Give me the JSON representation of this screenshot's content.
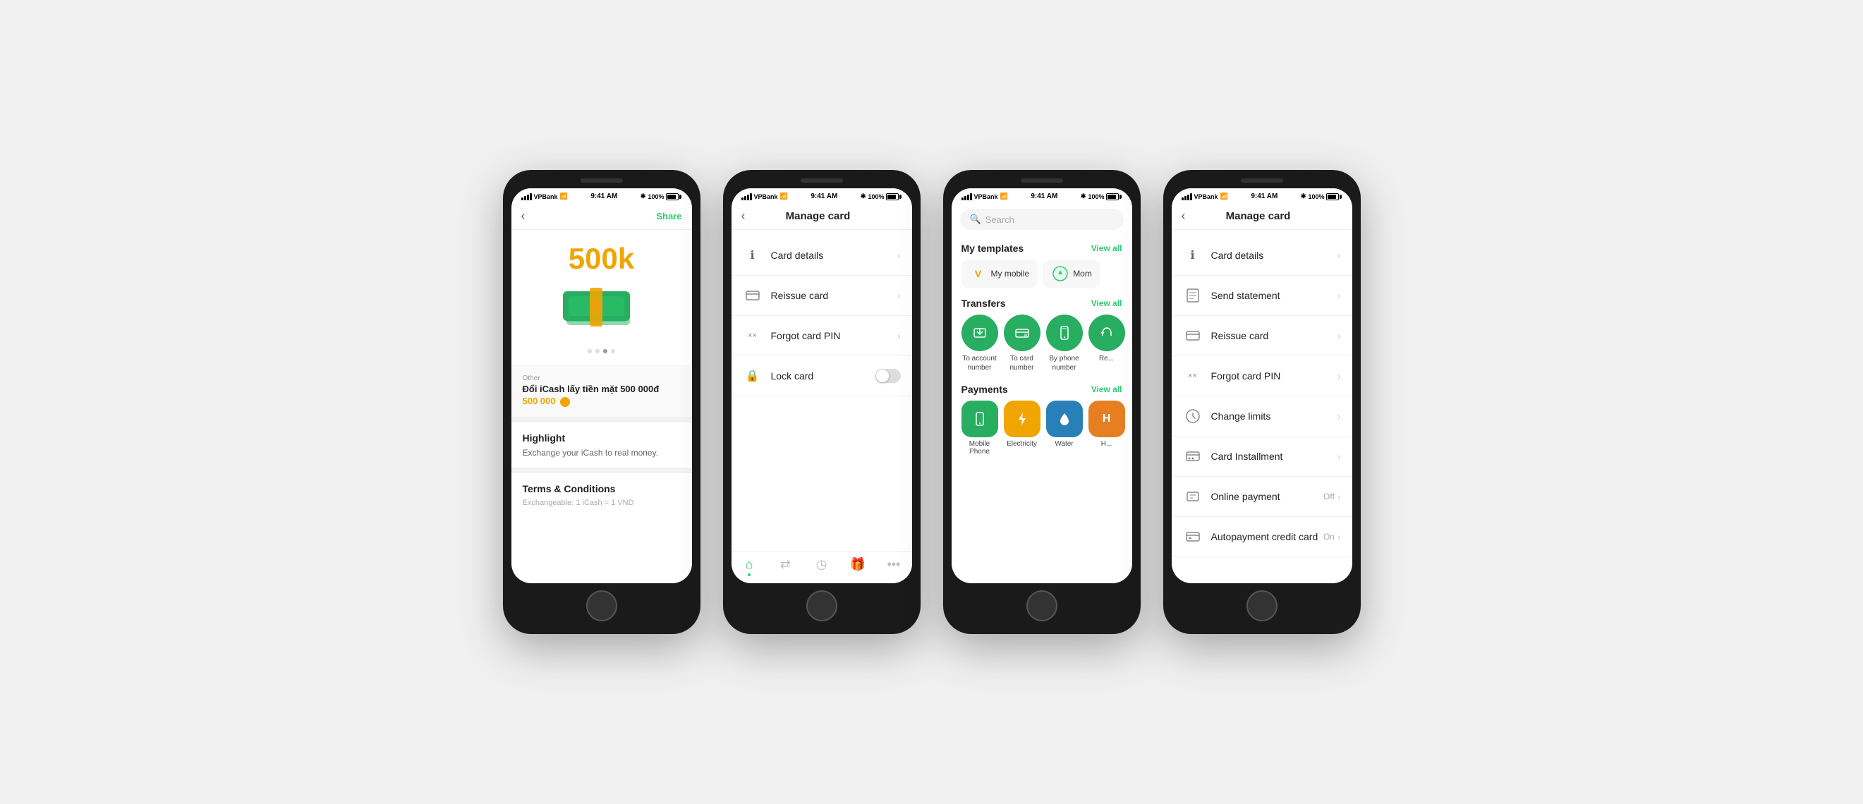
{
  "page": {
    "background": "#f0f0f0"
  },
  "statusBar": {
    "carrier": "VPBank",
    "time": "9:41 AM",
    "battery": "100%"
  },
  "phone1": {
    "navBack": "‹",
    "navAction": "Share",
    "amount": "500k",
    "category": "Other",
    "description": "Đổi iCash lấy tiền mặt 500 000đ",
    "amountValue": "500 000",
    "highlight": "Highlight",
    "highlightText": "Exchange your iCash to real money.",
    "tc": "Terms & Conditions",
    "tcText": "Exchangeable: 1 iCash = 1 VND"
  },
  "phone2": {
    "title": "Manage card",
    "navBack": "‹",
    "menuItems": [
      {
        "icon": "ℹ",
        "label": "Card details",
        "type": "chevron"
      },
      {
        "icon": "▭",
        "label": "Reissue card",
        "type": "chevron"
      },
      {
        "icon": "××",
        "label": "Forgot card PIN",
        "type": "chevron"
      },
      {
        "icon": "🔒",
        "label": "Lock card",
        "type": "toggle"
      }
    ],
    "tabs": [
      {
        "icon": "⌂",
        "label": "",
        "active": true
      },
      {
        "icon": "⇄",
        "label": "",
        "active": false
      },
      {
        "icon": "◷",
        "label": "",
        "active": false
      },
      {
        "icon": "🎁",
        "label": "",
        "active": false
      },
      {
        "icon": "•••",
        "label": "",
        "active": false
      }
    ]
  },
  "phone3": {
    "searchPlaceholder": "Search",
    "templates": {
      "title": "My templates",
      "viewAll": "View all",
      "items": [
        {
          "name": "My mobile",
          "logo": "V",
          "logoColor": "#f0a500"
        },
        {
          "name": "Mom",
          "logo": "V",
          "logoColor": "#2ecc71"
        }
      ]
    },
    "transfers": {
      "title": "Transfers",
      "viewAll": "View all",
      "items": [
        {
          "icon": "⌂",
          "label": "To account number"
        },
        {
          "icon": "▭",
          "label": "To card number"
        },
        {
          "icon": "📱",
          "label": "By phone number"
        },
        {
          "icon": "↩",
          "label": "Re..."
        }
      ]
    },
    "payments": {
      "title": "Payments",
      "viewAll": "View all",
      "items": [
        {
          "icon": "📱",
          "label": "Mobile Phone",
          "color": "#27ae60"
        },
        {
          "icon": "💡",
          "label": "Electricity",
          "color": "#f0a500"
        },
        {
          "icon": "💧",
          "label": "Water",
          "color": "#2980b9"
        },
        {
          "icon": "H",
          "label": "H...",
          "color": "#e67e22"
        }
      ]
    }
  },
  "phone4": {
    "title": "Manage card",
    "navBack": "‹",
    "menuItems": [
      {
        "icon": "ℹ",
        "label": "Card details",
        "type": "chevron",
        "value": ""
      },
      {
        "icon": "▤",
        "label": "Send statement",
        "type": "chevron",
        "value": ""
      },
      {
        "icon": "▭",
        "label": "Reissue card",
        "type": "chevron",
        "value": ""
      },
      {
        "icon": "××",
        "label": "Forgot card PIN",
        "type": "chevron",
        "value": ""
      },
      {
        "icon": "⚙",
        "label": "Change limits",
        "type": "chevron",
        "value": ""
      },
      {
        "icon": "▬",
        "label": "Card Installment",
        "type": "chevron",
        "value": ""
      },
      {
        "icon": "🛒",
        "label": "Online payment",
        "type": "chevron",
        "value": "Off"
      },
      {
        "icon": "▦",
        "label": "Autopayment credit card",
        "type": "chevron",
        "value": "On"
      }
    ]
  }
}
